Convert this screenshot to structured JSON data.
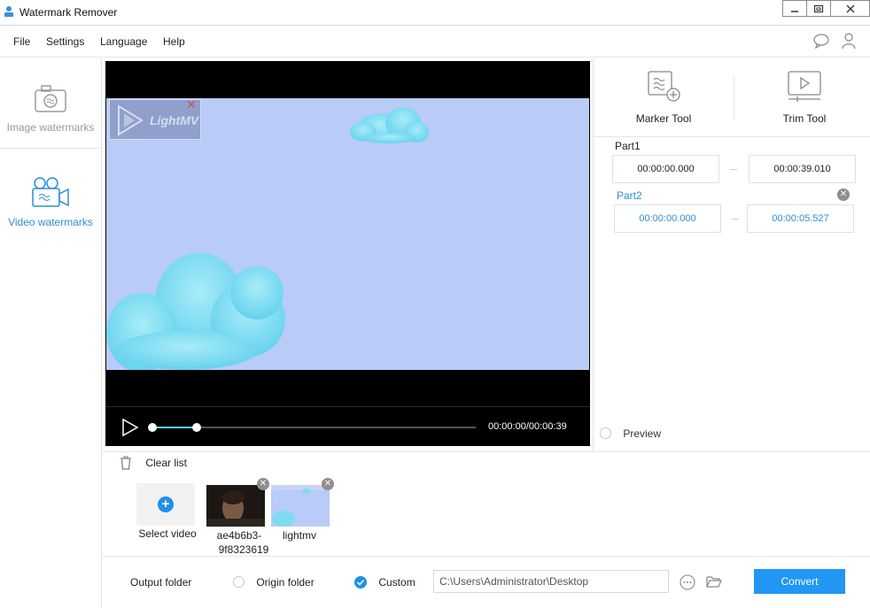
{
  "window": {
    "title": "Watermark Remover"
  },
  "menu": {
    "items": [
      "File",
      "Settings",
      "Language",
      "Help"
    ]
  },
  "sidebar": {
    "items": [
      {
        "label": "Image watermarks",
        "icon": "camera-icon"
      },
      {
        "label": "Video watermarks",
        "icon": "video-camera-icon"
      }
    ],
    "active": "Video watermarks"
  },
  "player": {
    "time": "00:00:00/00:00:39",
    "watermark_text": "LightMV",
    "progress": 0.14
  },
  "tools": {
    "marker": "Marker Tool",
    "trim": "Trim Tool"
  },
  "parts": [
    {
      "label": "Part1",
      "start": "00:00:00.000",
      "end": "00:00:39.010"
    },
    {
      "label": "Part2",
      "start": "00:00:00.000",
      "end": "00:00:05.527"
    }
  ],
  "preview_label": "Preview",
  "list": {
    "clear_label": "Clear list",
    "select_label": "Select video",
    "files": [
      {
        "name_line1": "ae4b6b3-",
        "name_line2": "9f8323619"
      },
      {
        "name_line1": "lightmv",
        "name_line2": ""
      }
    ]
  },
  "footer": {
    "output_label": "Output folder",
    "origin_label": "Origin folder",
    "custom_label": "Custom",
    "path": "C:\\Users\\Administrator\\Desktop",
    "convert_label": "Convert"
  },
  "colors": {
    "accent": "#1e90e8",
    "video_bg": "#b9cbf7",
    "cloud": "#7fdcf0"
  }
}
